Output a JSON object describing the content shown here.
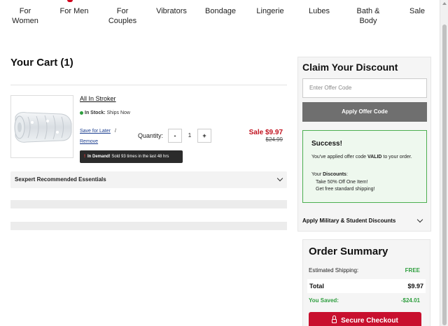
{
  "nav": {
    "items": [
      {
        "label": "For Women"
      },
      {
        "label": "For Men"
      },
      {
        "label": "For Couples"
      },
      {
        "label": "Vibrators"
      },
      {
        "label": "Bondage"
      },
      {
        "label": "Lingerie"
      },
      {
        "label": "Lubes"
      },
      {
        "label": "Bath &\nBody"
      },
      {
        "label": "Sale"
      }
    ]
  },
  "cart": {
    "title": "Your Cart (1)",
    "item": {
      "name": "All In Stroker",
      "stock_status": "In Stock:",
      "stock_detail": "Ships Now",
      "save_for_later": "Save for Later",
      "separator": "/",
      "remove": "Remove",
      "quantity_label": "Quantity:",
      "quantity": "1",
      "minus": "-",
      "plus": "+",
      "sale_price": "Sale $9.97",
      "original_price": "$24.99",
      "demand_bold": "In Demand!",
      "demand_text": "Sold 93 times in the last 48 hrs",
      "demand_icon": "!"
    },
    "essentials_label": "Sexpert Recommended Essentials"
  },
  "discount": {
    "title": "Claim Your Discount",
    "input_placeholder": "Enter Offer Code",
    "apply_label": "Apply Offer Code",
    "success_title": "Success!",
    "success_pre": "You've applied offer code ",
    "success_code": "VALID",
    "success_post": " to your order.",
    "discounts_pre": "Your ",
    "discounts_bold": "Discounts",
    "discounts_colon": ":",
    "discount_lines": [
      "Take 50% Off One Item!",
      "Get free standard shipping!"
    ],
    "military_label": "Apply Military & Student Discounts"
  },
  "summary": {
    "title": "Order Summary",
    "shipping_label": "Estimated Shipping:",
    "shipping_value": "FREE",
    "total_label": "Total",
    "total_value": "$9.97",
    "saved_label": "You Saved:",
    "saved_value": "-$24.01",
    "checkout_label": "Secure Checkout"
  },
  "colors": {
    "accent": "#c8102e",
    "sale": "#c1121f",
    "success_green": "#2e9e3e",
    "link": "#1a3d8f"
  }
}
